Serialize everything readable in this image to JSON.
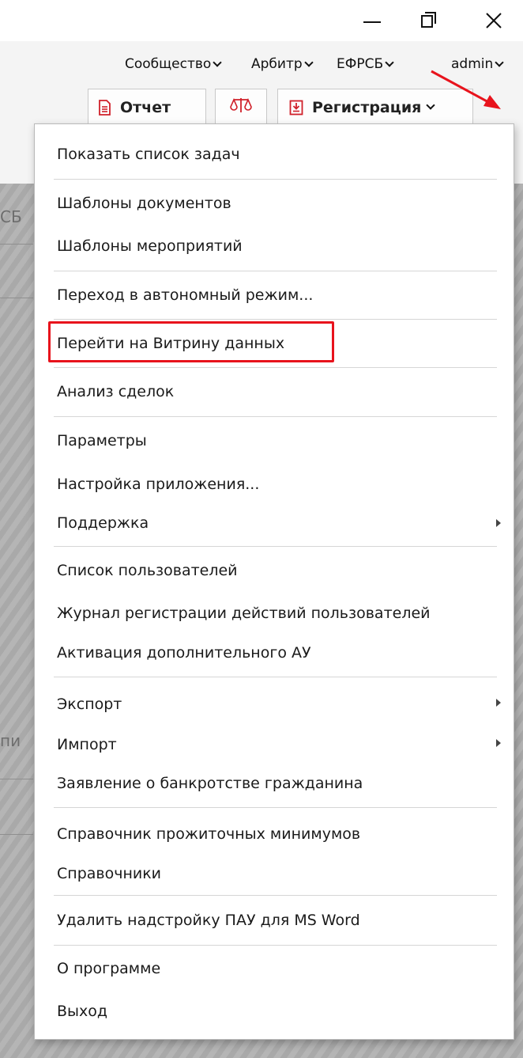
{
  "window": {
    "minimize_icon": "minimize-icon",
    "restore_icon": "restore-icon",
    "close_icon": "close-icon"
  },
  "topnav": {
    "community": "Сообщество",
    "arbitr": "Арбитр",
    "efrsb": "ЕФРСБ",
    "admin": "admin"
  },
  "toolbar": {
    "report_label": "Отчет",
    "register_label": "Регистрация",
    "scales_icon": "scales-icon",
    "menu_icon": "hamburger-menu-icon"
  },
  "background": {
    "fragment_top": "СБ",
    "fragment_mid": "пи"
  },
  "menu": {
    "show_tasks": "Показать список задач",
    "doc_templates": "Шаблоны документов",
    "event_templates": "Шаблоны мероприятий",
    "offline_mode": "Переход в автономный режим...",
    "data_showcase": "Перейти на Витрину данных",
    "deal_analysis": "Анализ сделок",
    "parameters": "Параметры",
    "app_settings": "Настройка приложения...",
    "support": "Поддержка",
    "user_list": "Список пользователей",
    "user_journal": "Журнал регистрации действий пользователей",
    "activate_au": "Активация дополнительного АУ",
    "export": "Экспорт",
    "import": "Импорт",
    "bankruptcy": "Заявление о банкротстве гражданина",
    "subsistence": "Справочник прожиточных минимумов",
    "references": "Справочники",
    "remove_addin": "Удалить надстройку ПАУ для MS Word",
    "about": "О программе",
    "exit": "Выход"
  },
  "colors": {
    "highlight": "#e8131c",
    "annotation_arrow": "#e8131c",
    "backdrop_stripes": "#b5b5b5"
  }
}
